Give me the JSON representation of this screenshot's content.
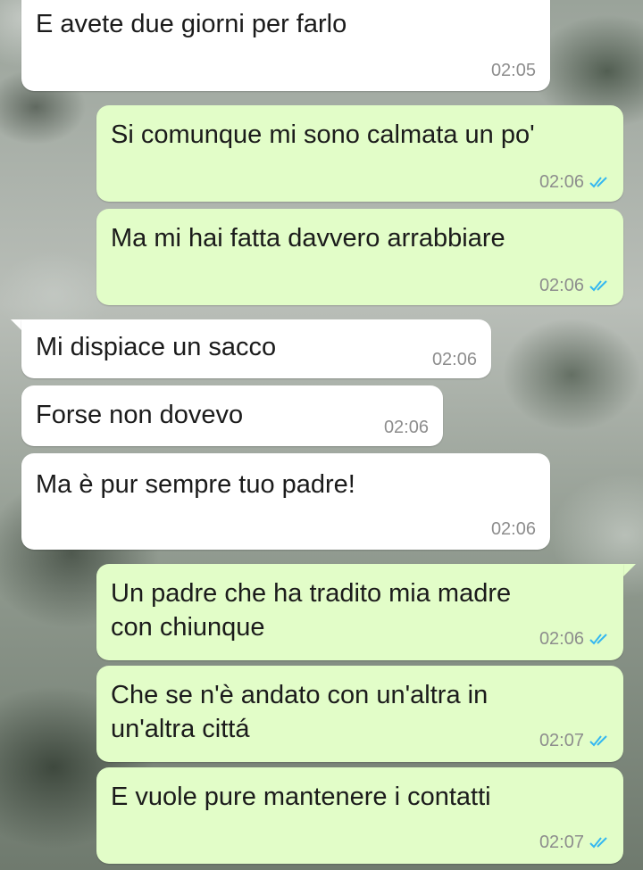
{
  "messages": [
    {
      "side": "in",
      "text": "E avete due giorni per farlo",
      "time": "02:05"
    },
    {
      "side": "out",
      "text": "Si comunque mi sono calmata un po'",
      "time": "02:06",
      "status": "read-double-check-icon"
    },
    {
      "side": "out",
      "text": "Ma mi hai fatta davvero arrabbiare",
      "time": "02:06",
      "status": "read-double-check-icon"
    },
    {
      "side": "in",
      "text": "Mi dispiace un sacco",
      "time": "02:06"
    },
    {
      "side": "in",
      "text": "Forse non dovevo",
      "time": "02:06"
    },
    {
      "side": "in",
      "text": "Ma è pur sempre tuo padre!",
      "time": "02:06"
    },
    {
      "side": "out",
      "text": "Un padre che ha tradito mia madre\ncon chiunque",
      "time": "02:06",
      "status": "read-double-check-icon"
    },
    {
      "side": "out",
      "text": "Che se n'è andato con un'altra in\nun'altra cittá",
      "time": "02:07",
      "status": "read-double-check-icon"
    },
    {
      "side": "out",
      "text": "E vuole pure mantenere i contatti",
      "time": "02:07",
      "status": "read-double-check-icon"
    }
  ],
  "colors": {
    "incoming_bubble": "#ffffff",
    "outgoing_bubble": "#e2fdc8",
    "time_text": "#8d8d8d",
    "read_ticks": "#34b7f1"
  }
}
